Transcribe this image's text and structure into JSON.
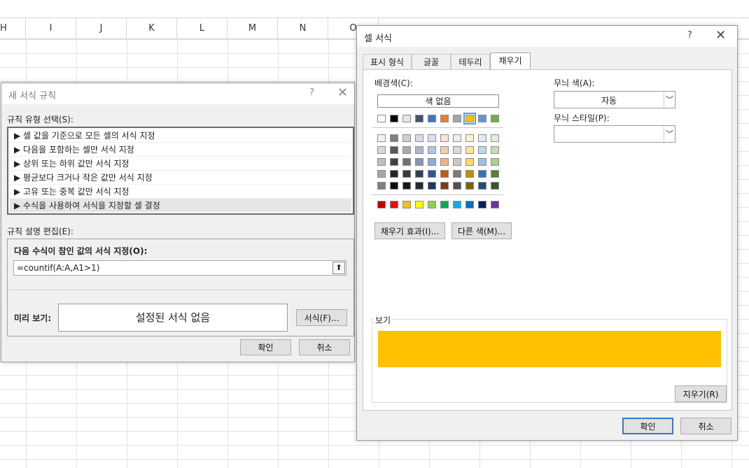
{
  "sheet": {
    "columns": [
      "H",
      "I",
      "J",
      "K",
      "L",
      "M",
      "N",
      "O"
    ]
  },
  "rule_dialog": {
    "title": "새 서식 규칙",
    "help": "?",
    "close": "✕",
    "select_type_label": "규칙 유형 선택(S):",
    "rule_types": [
      "▶ 셀 값을 기준으로 모든 셀의 서식 지정",
      "▶ 다음을 포함하는 셀만 서식 지정",
      "▶ 상위 또는 하위 값만 서식 지정",
      "▶ 평균보다 크거나 작은 값만 서식 지정",
      "▶ 고유 또는 중복 값만 서식 지정",
      "▶ 수식을 사용하여 서식을 지정할 셀 결정"
    ],
    "edit_label": "규칙 설명 편집(E):",
    "formula_label": "다음 수식이 참인 값의 서식 지정(O):",
    "formula_value": "=countif(A:A,A1>1)",
    "preview_label": "미리 보기:",
    "preview_text": "설정된 서식 없음",
    "format_button": "서식(F)...",
    "ok": "확인",
    "cancel": "취소"
  },
  "format_dialog": {
    "title": "셀 서식",
    "help": "?",
    "close": "✕",
    "tabs": [
      "표시 형식",
      "글꼴",
      "테두리",
      "채우기"
    ],
    "active_tab": "채우기",
    "bg_color_label": "배경색(C):",
    "no_color": "색 없음",
    "pattern_color_label": "무늬 색(A):",
    "pattern_color_value": "자동",
    "pattern_style_label": "무늬 스타일(P):",
    "pattern_style_value": "",
    "fill_effects_button": "채우기 효과(I)...",
    "more_colors_button": "다른 색(M)...",
    "sample_label": "보기",
    "clear_button": "지우기(R)",
    "ok": "확인",
    "cancel": "취소",
    "selected_color": "#FFC000",
    "theme_colors": [
      "#FFFFFF",
      "#000000",
      "#E7E6E6",
      "#44546A",
      "#4472C4",
      "#ED7D31",
      "#A5A5A5",
      "#FFC000",
      "#5B9BD5",
      "#70AD47"
    ],
    "tint_rows": [
      [
        "#F2F2F2",
        "#7F7F7F",
        "#D0CECE",
        "#D6DCE4",
        "#D9E1F2",
        "#FCE4D6",
        "#EDEDED",
        "#FFF2CC",
        "#DDEBF7",
        "#E2EFDA"
      ],
      [
        "#D9D9D9",
        "#595959",
        "#AEAAAA",
        "#ACB9CA",
        "#B4C6E7",
        "#F8CBAD",
        "#DBDBDB",
        "#FFE699",
        "#BDD7EE",
        "#C6E0B4"
      ],
      [
        "#BFBFBF",
        "#404040",
        "#757171",
        "#8497B0",
        "#8EA9DB",
        "#F4B084",
        "#C9C9C9",
        "#FFD966",
        "#9BC2E6",
        "#A9D08E"
      ],
      [
        "#A6A6A6",
        "#262626",
        "#3A3838",
        "#333F4F",
        "#2F5597",
        "#C65911",
        "#7B7B7B",
        "#BF8F00",
        "#2F75B5",
        "#548235"
      ],
      [
        "#808080",
        "#0D0D0D",
        "#161616",
        "#222B35",
        "#203764",
        "#833C0C",
        "#525252",
        "#806000",
        "#1F4E78",
        "#375623"
      ]
    ],
    "standard_colors": [
      "#C00000",
      "#FF0000",
      "#FFC000",
      "#FFFF00",
      "#92D050",
      "#00B050",
      "#00B0F0",
      "#0070C0",
      "#002060",
      "#7030A0"
    ]
  }
}
